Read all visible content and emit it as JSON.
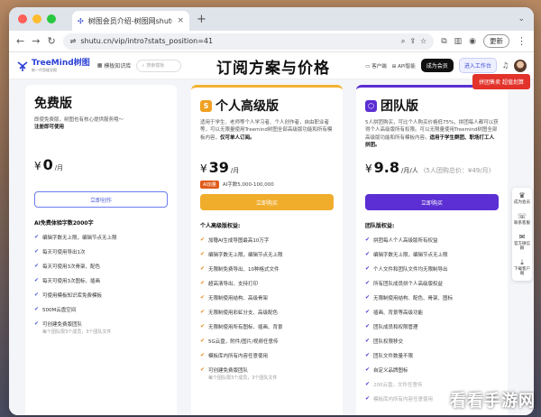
{
  "browser": {
    "tab_title": "树图会员介绍-树图网shutu.cn-",
    "url": "shutu.cn/vip/intro?stats_position=41",
    "update_label": "更新"
  },
  "site": {
    "logo_name": "TreeMind树图",
    "logo_sub": "新一代思维导图",
    "nav_template_library": "模板知识库",
    "search_placeholder": "搜索模板",
    "hero_title": "订阅方案与价格",
    "nav_client": "客户端",
    "nav_api": "API智能",
    "btn_member": "成为会员",
    "btn_enter_workspace": "进入工作台"
  },
  "promo_label": "拼团售卖 超值划算",
  "plans": [
    {
      "name": "免费版",
      "desc": "即使免费版，树图也有核心提供服务哦～",
      "desc_bold": "注册即可使用",
      "currency": "¥",
      "price": "0",
      "unit": "/月",
      "button": "立即创作",
      "features_title": "AI免费体验字数2000字",
      "features": [
        {
          "text": "编辑字数无上限，编辑节点无上限"
        },
        {
          "text": "每天可使用导出1次"
        },
        {
          "text": "每天可使用3次骨架、配色"
        },
        {
          "text": "每天可使用3次图标、插画"
        },
        {
          "text": "可使用模板知识库免费模板"
        },
        {
          "text": "500M云盘空间"
        },
        {
          "text": "可创建免费版团队",
          "sub": "每个团队限3个成员，3个团队文件"
        }
      ]
    },
    {
      "name": "个人高级版",
      "desc": "适用于学生、老师等个人学习者、个人创作者，自由职业者等，可以无限量使用Treemind树图全部高级版功能和所有模板内容，",
      "desc_bold": "仅可单人订阅。",
      "currency": "¥",
      "price": "39",
      "unit": "/月",
      "tag": "AI加量",
      "tag_text": "AI字数5,000-100,000",
      "button": "立即购买",
      "features_title": "个人高级版权益:",
      "features": [
        {
          "text": "加赠AI生成导图最高10万字"
        },
        {
          "text": "编辑字数无上限，编辑节点无上限"
        },
        {
          "text": "无限制免费导出、10种格式文件"
        },
        {
          "text": "超高清导出、支持打印"
        },
        {
          "text": "无限制使用结构、高级骨架"
        },
        {
          "text": "无限制使用彩虹分支、高级配色"
        },
        {
          "text": "无限制使用所有图标、插画、背景"
        },
        {
          "text": "5G云盘，附件/图片/视频任意传"
        },
        {
          "text": "模板库内所有内容任意使用"
        },
        {
          "text": "可创建免费版团队",
          "sub": "每个团队限3个成员，3个团队文件"
        }
      ]
    },
    {
      "name": "团队版",
      "desc": "5人拼团购买，可比个人购买价格低75%，拼团每人都可以获得个人高级版所有权限。可以无限量使用Treemind树图全部高级版功能和所有模板内容。",
      "desc_bold": "适用于学生群团、职场打工人拼团。",
      "currency": "¥",
      "price": "9.8",
      "unit": "/月/人",
      "price_extra": "(5人团购总价：¥49/月)",
      "button": "立即购买",
      "features_title": "团队版权益:",
      "features": [
        {
          "text": "拼团每人个人高级版所有权益"
        },
        {
          "text": "编辑字数无上限，编辑节点无上限"
        },
        {
          "text": "个人文件和团队文件均无限制导出"
        },
        {
          "text": "所有团队成员拼个人高级版权益"
        },
        {
          "text": "无限制使用结构、配色、骨架、图标"
        },
        {
          "text": "插画、背景等高级功能"
        },
        {
          "text": "团队成员和权限管理"
        },
        {
          "text": "团队权限移交"
        },
        {
          "text": "团队文件数量不限"
        },
        {
          "text": "自定义品牌图标"
        },
        {
          "text": "200云盘，文件任意传",
          "dim": true
        },
        {
          "text": "模板库内所有内容任意使用",
          "dim": true
        }
      ]
    }
  ],
  "sidebar": [
    {
      "icon": "vip-icon",
      "label": "成为会员"
    },
    {
      "icon": "support-icon",
      "label": "联系客服"
    },
    {
      "icon": "wechat-icon",
      "label": "官方微信群"
    },
    {
      "icon": "download-icon",
      "label": "下载客户端"
    }
  ],
  "watermark": "看看手游网"
}
